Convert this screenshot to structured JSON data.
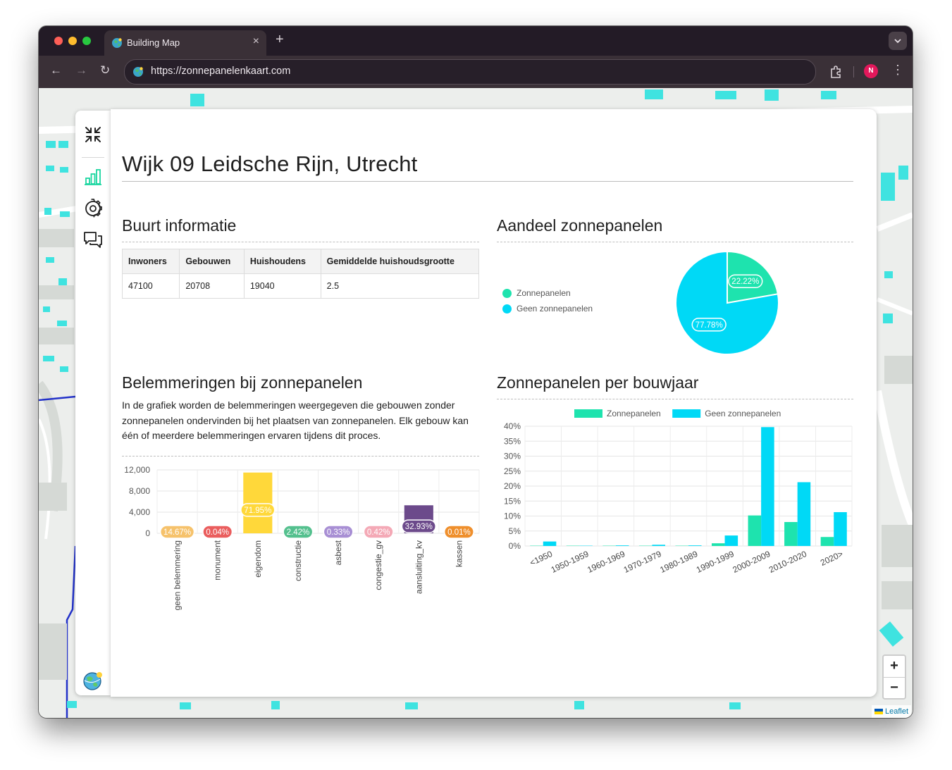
{
  "browser": {
    "tab_title": "Building Map",
    "tab_close": "×",
    "new_tab": "+",
    "url": "https://zonnepanelenkaart.com",
    "profile_initial": "N",
    "tab_menu": "⌄",
    "back": "←",
    "forward": "→",
    "reload": "↻",
    "kebab": "⋮"
  },
  "sidebar": {
    "items": [
      {
        "name": "collapse-icon"
      },
      {
        "name": "bar-chart-icon",
        "active": true
      },
      {
        "name": "gear-icon"
      },
      {
        "name": "chat-icon"
      },
      {
        "name": "logo-globe-icon"
      }
    ],
    "active_color": "#1bd6a0"
  },
  "panel": {
    "title": "Wijk 09 Leidsche Rijn, Utrecht",
    "info": {
      "heading": "Buurt informatie",
      "columns": [
        "Inwoners",
        "Gebouwen",
        "Huishoudens",
        "Gemiddelde huishoudsgrootte"
      ],
      "rows": [
        [
          "47100",
          "20708",
          "19040",
          "2.5"
        ]
      ]
    },
    "share": {
      "heading": "Aandeel zonnepanelen"
    },
    "obstacles": {
      "heading": "Belemmeringen bij zonnepanelen",
      "description": "In de grafiek worden de belemmeringen weergegeven die gebouwen zonder zonnepanelen ondervinden bij het plaatsen van zonnepanelen. Elk gebouw kan één of meerdere belemmeringen ervaren tijdens dit proces."
    },
    "by_year": {
      "heading": "Zonnepanelen per bouwjaar"
    }
  },
  "map": {
    "zoom_in": "+",
    "zoom_out": "−",
    "attribution": "Leaflet"
  },
  "chart_data": [
    {
      "id": "pie",
      "type": "pie",
      "title": "Aandeel zonnepanelen",
      "legend_position": "left",
      "slices": [
        {
          "label": "Zonnepanelen",
          "value": 22.22,
          "display": "22.22%",
          "color": "#1ee3ae"
        },
        {
          "label": "Geen zonnepanelen",
          "value": 77.78,
          "display": "77.78%",
          "color": "#00d9f6"
        }
      ]
    },
    {
      "id": "obstacles",
      "type": "bar",
      "title": "Belemmeringen bij zonnepanelen",
      "categories": [
        "geen belemmering",
        "monument",
        "eigendom",
        "constructie",
        "asbest",
        "congestie_gv",
        "aansluiting_kv",
        "kassen"
      ],
      "values": [
        0,
        0,
        11500,
        0,
        0,
        0,
        5300,
        0
      ],
      "data_labels": [
        "14.67%",
        "0.04%",
        "71.95%",
        "2.42%",
        "0.33%",
        "0.42%",
        "32.93%",
        "0.01%"
      ],
      "colors": [
        "#f6c26b",
        "#ea5d5d",
        "#ffd83a",
        "#54c08e",
        "#a88fd4",
        "#f4a9b6",
        "#6c4a8b",
        "#ef8f2c"
      ],
      "yticks": [
        "0",
        "4,000",
        "8,000",
        "12,000"
      ],
      "ylim": [
        0,
        12000
      ],
      "grid": true
    },
    {
      "id": "by_year",
      "type": "bar",
      "title": "Zonnepanelen per bouwjaar",
      "legend_position": "top",
      "categories": [
        "<1950",
        "1950-1959",
        "1960-1969",
        "1970-1979",
        "1980-1989",
        "1990-1999",
        "2000-2009",
        "2010-2020",
        "2020>"
      ],
      "series": [
        {
          "name": "Zonnepanelen",
          "color": "#1ee3ae",
          "values": [
            0.1,
            0.1,
            0.1,
            0.1,
            0.1,
            0.9,
            10.2,
            8.0,
            3.0
          ]
        },
        {
          "name": "Geen zonnepanelen",
          "color": "#00d9f6",
          "values": [
            1.5,
            0.1,
            0.2,
            0.4,
            0.2,
            3.5,
            39.7,
            21.3,
            11.3
          ]
        }
      ],
      "yticks": [
        "0%",
        "5%",
        "10%",
        "15%",
        "20%",
        "25%",
        "30%",
        "35%",
        "40%"
      ],
      "ylim": [
        0,
        40
      ],
      "grid": true
    }
  ]
}
